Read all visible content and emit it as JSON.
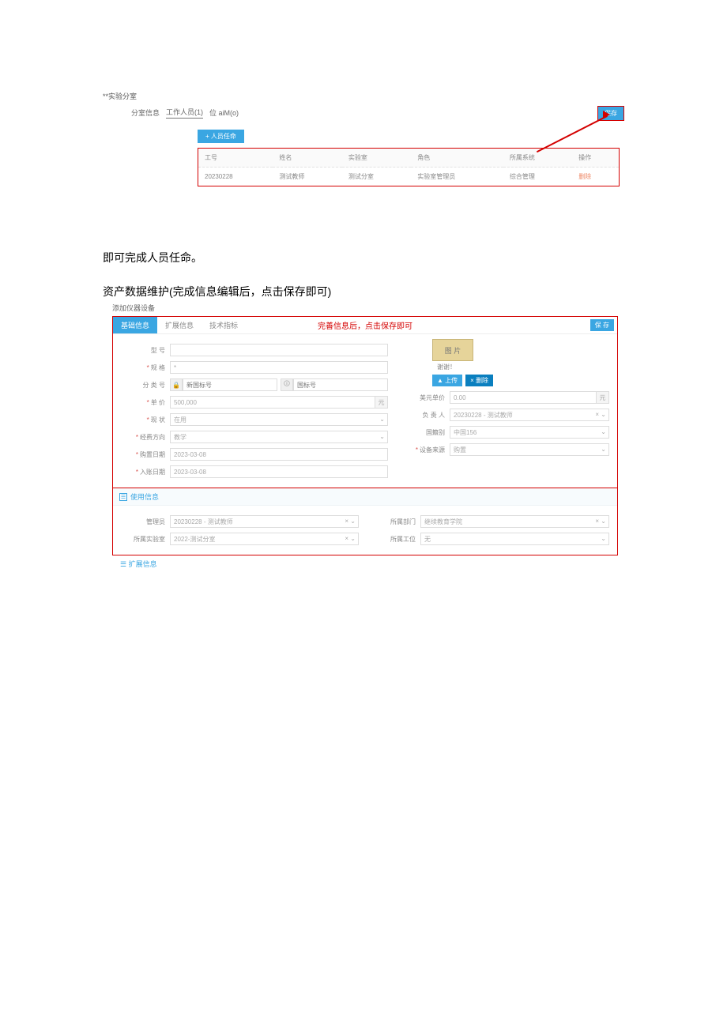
{
  "section1": {
    "title": "**实验分室",
    "tab_info": "分室信息",
    "tab_workers": "工作人员(1)",
    "tab_bim": "位 aiM(o)",
    "save_btn": "保存",
    "add_person_btn": "+ 人员任命",
    "headers": [
      "工号",
      "姓名",
      "实验室",
      "角色",
      "所属系统",
      "操作"
    ],
    "row": {
      "id": "20230228",
      "name": "测试教师",
      "lab": "测试分室",
      "role": "实验室管理员",
      "sys": "综合管理",
      "action": "删除"
    }
  },
  "body_line1": "即可完成人员任命。",
  "body_line2": "资产数据维护(完成信息编辑后，点击保存即可)",
  "crumb": "添加仪器设备",
  "form": {
    "tabs": {
      "basic": "基础信息",
      "ext": "扩展信息",
      "tech": "技术指标"
    },
    "hint": "完善信息后，点击保存即可",
    "save": "保 存",
    "label_model": "型   号",
    "label_spec": "规   格",
    "label_catno": "分 类 号",
    "label_price": "单   价",
    "label_status": "现   状",
    "label_funding": "经费方向",
    "label_buydate": "购置日期",
    "label_indate": "入账日期",
    "pic_text": "图 片",
    "pic_thanks": "谢谢！",
    "btn_upload": "▲ 上传",
    "btn_remove": "× 删除",
    "label_usd": "美元单价",
    "label_owner": "负 责 人",
    "label_country": "国籍别",
    "label_src": "设备来源",
    "val_model": "",
    "val_spec": "*",
    "catno_lock": "🔒",
    "catno_ph": "新国标号",
    "catno_old_lock": "🛈",
    "catno_old_ph": "国标号",
    "val_price": "500,000",
    "unit_yuan": "元",
    "val_status": "在用",
    "val_funding": "教学",
    "val_buydate": "2023-03-08",
    "val_indate": "2023-03-08",
    "val_usd": "0.00",
    "val_owner": "20230228 - 测试教师",
    "val_country": "中国156",
    "val_src": "购置",
    "use_hdr": "使用信息",
    "label_mgr": "管理员",
    "label_dept": "所属部门",
    "label_ulab": "所属实验室",
    "label_site": "所属工位",
    "val_mgr": "20230228 - 测试教师",
    "val_dept": "继续教育学院",
    "val_ulab": "2022-测试分室",
    "val_site": "无",
    "ext_hdr": "☰ 扩展信息"
  }
}
